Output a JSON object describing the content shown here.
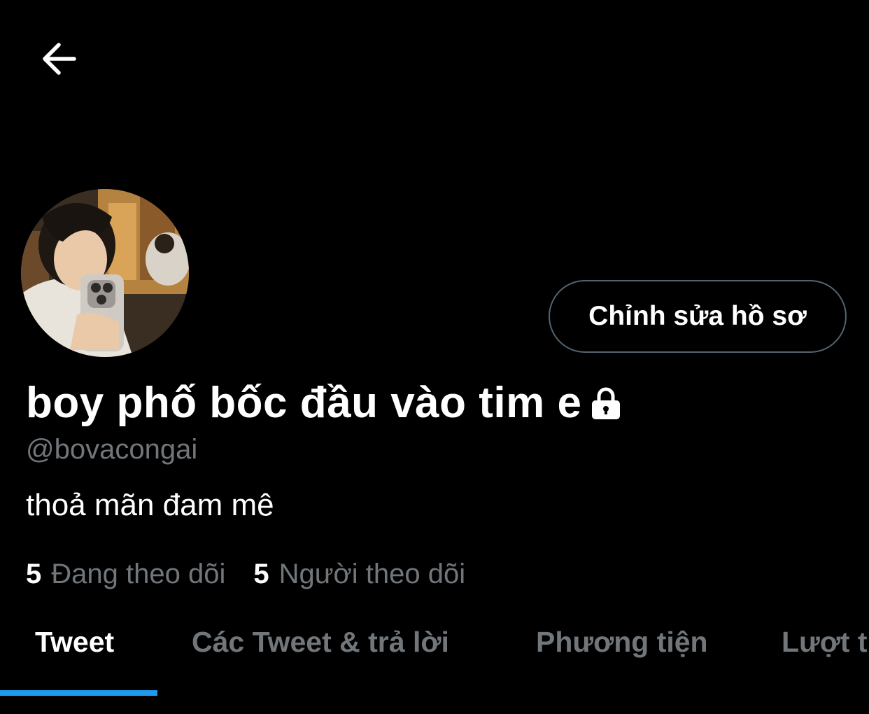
{
  "header": {
    "back_icon": "arrow-left-icon"
  },
  "profile": {
    "display_name": "boy phố bốc đầu vào tim e",
    "protected_icon": "lock-icon",
    "handle": "@bovacongai",
    "bio": "thoả mãn đam mê",
    "edit_button_label": "Chỉnh sửa hồ sơ"
  },
  "stats": {
    "following_count": "5",
    "following_label": "Đang theo dõi",
    "followers_count": "5",
    "followers_label": "Người theo dõi"
  },
  "tabs": [
    {
      "label": "Tweet",
      "active": true
    },
    {
      "label": "Các Tweet & trả lời",
      "active": false
    },
    {
      "label": "Phương tiện",
      "active": false
    },
    {
      "label": "Lượt thích",
      "active": false
    }
  ],
  "colors": {
    "background": "#000000",
    "primary_text": "#ffffff",
    "secondary_text": "#71767b",
    "accent": "#1d9bf0",
    "button_border": "#536471"
  }
}
